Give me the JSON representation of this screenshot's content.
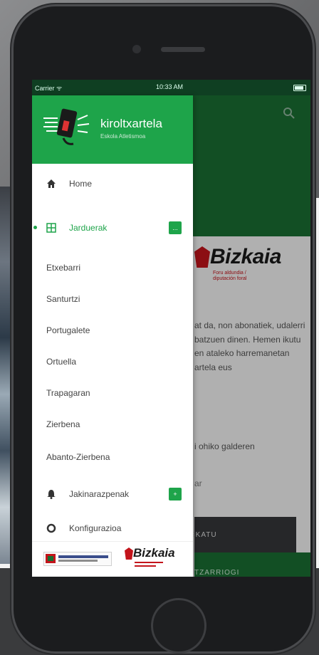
{
  "status_bar": {
    "carrier": "Carrier ᯤ",
    "time": "10:33 AM"
  },
  "drawer": {
    "app_title": "kiroltxartela",
    "app_subtitle": "Eskola Atletismoa"
  },
  "menu": [
    {
      "label": "Home",
      "icon": "home-icon"
    },
    {
      "label": "Jarduerak",
      "icon": "grid-icon",
      "badge": "...",
      "active": true
    },
    {
      "label": "Etxebarri"
    },
    {
      "label": "Santurtzi"
    },
    {
      "label": "Portugalete"
    },
    {
      "label": "Ortuella"
    },
    {
      "label": "Trapagaran"
    },
    {
      "label": "Zierbena"
    },
    {
      "label": "Abanto-Zierbena"
    },
    {
      "label": "Jakinarazpenak",
      "icon": "bell-icon",
      "badge": "+"
    },
    {
      "label": "Konfigurazioa",
      "icon": "settings-icon"
    }
  ],
  "background_content": {
    "logo_text": "Bizkaia",
    "logo_subtext": "Foru aldundia / diputación foral",
    "paragraph": "at da, non abonatiek, udalerri batzuen dinen. Hemen ikutu en ataleko harremanetan artela eus",
    "faq_line": "i ohiko galderen",
    "faded_text": "ar",
    "dark_button": "SKATU",
    "green_button": "TZARRIOGI"
  },
  "footer": {
    "eusko_label": "Eusko Jaurlaritza",
    "biz_label": "Bizkaia"
  },
  "colors": {
    "green": "#1ea44a",
    "dark_green": "#1a6e33",
    "red": "#c3141b"
  }
}
